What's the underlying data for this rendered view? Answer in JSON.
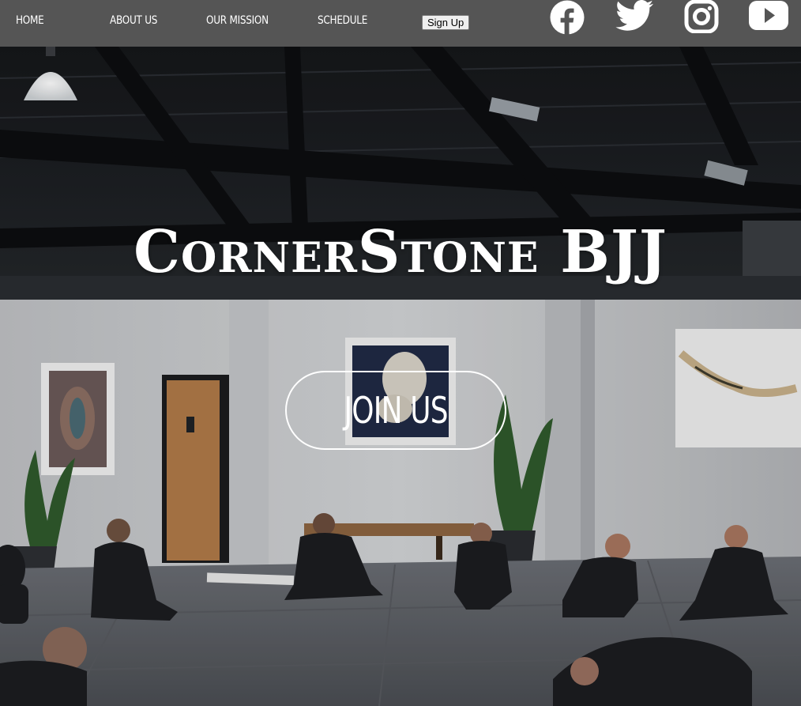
{
  "nav": {
    "links": [
      {
        "label": "HOME"
      },
      {
        "label": "ABOUT US"
      },
      {
        "label": "OUR MISSION"
      },
      {
        "label": "SCHEDULE"
      }
    ],
    "signup_label": "Sign Up"
  },
  "social": {
    "icons": [
      "facebook-icon",
      "twitter-icon",
      "instagram-icon",
      "youtube-icon"
    ],
    "color": "#ffffff"
  },
  "hero": {
    "title": "CornerStone BJJ",
    "cta_label": "JOIN US"
  },
  "colors": {
    "navbar": "#555555",
    "hero_text": "#ffffff",
    "mat": "#5d6066",
    "wall": "#c9cbce"
  }
}
